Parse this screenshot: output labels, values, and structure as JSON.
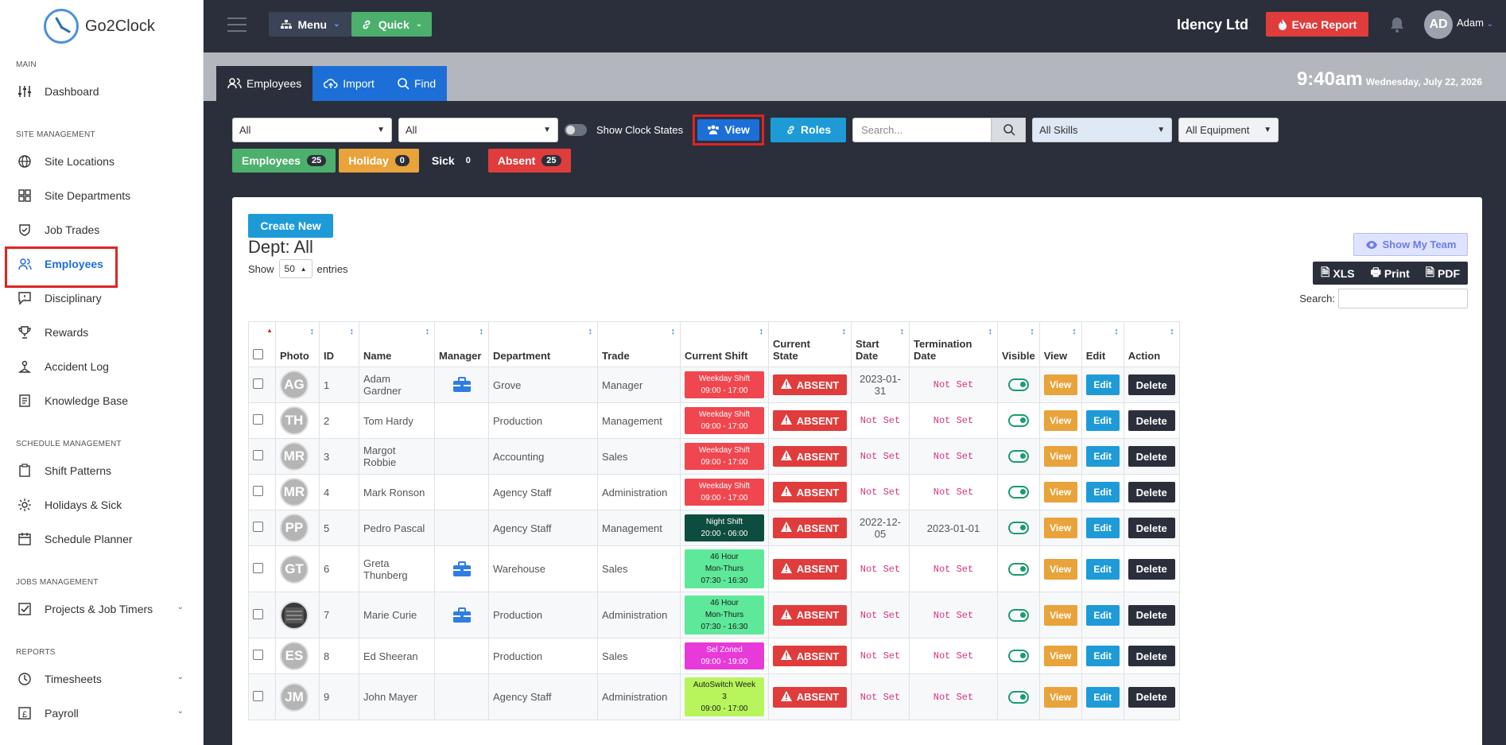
{
  "app": {
    "brand": "Go2Clock"
  },
  "sidebar": {
    "sections": [
      {
        "title": "MAIN",
        "items": [
          {
            "label": "Dashboard",
            "icon": "sliders-icon"
          }
        ]
      },
      {
        "title": "SITE MANAGEMENT",
        "items": [
          {
            "label": "Site Locations",
            "icon": "globe-icon"
          },
          {
            "label": "Site Departments",
            "icon": "grid-icon"
          },
          {
            "label": "Job Trades",
            "icon": "shield-icon"
          },
          {
            "label": "Employees",
            "icon": "users-icon",
            "active": true
          },
          {
            "label": "Disciplinary",
            "icon": "message-icon"
          },
          {
            "label": "Rewards",
            "icon": "trophy-icon"
          },
          {
            "label": "Accident Log",
            "icon": "hazard-icon"
          },
          {
            "label": "Knowledge Base",
            "icon": "book-icon"
          }
        ]
      },
      {
        "title": "SCHEDULE MANAGEMENT",
        "items": [
          {
            "label": "Shift Patterns",
            "icon": "clipboard-icon"
          },
          {
            "label": "Holidays & Sick",
            "icon": "sun-icon"
          },
          {
            "label": "Schedule Planner",
            "icon": "calendar-icon"
          }
        ]
      },
      {
        "title": "JOBS MANAGEMENT",
        "items": [
          {
            "label": "Projects & Job Timers",
            "icon": "checkbox-icon",
            "expandable": true
          }
        ]
      },
      {
        "title": "REPORTS",
        "items": [
          {
            "label": "Timesheets",
            "icon": "clock-icon",
            "expandable": true
          },
          {
            "label": "Payroll",
            "icon": "pound-icon",
            "expandable": true
          }
        ]
      }
    ]
  },
  "topbar": {
    "menu_label": "Menu",
    "quick_label": "Quick",
    "company": "Idency Ltd",
    "evac_label": "Evac Report",
    "avatar_initials": "AD",
    "user_name": "Adam"
  },
  "tabs": [
    {
      "label": "Employees",
      "icon": "users-icon",
      "active": true
    },
    {
      "label": "Import",
      "icon": "cloud-upload-icon"
    },
    {
      "label": "Find",
      "icon": "search-icon"
    }
  ],
  "clock": {
    "time": "9:40am",
    "date": "Wednesday, July 22, 2026"
  },
  "filters": {
    "select1": "All",
    "select2": "All",
    "show_clock_states": "Show Clock States",
    "view_label": "View",
    "roles_label": "Roles",
    "search_placeholder": "Search...",
    "skills": "All Skills",
    "equipment": "All Equipment"
  },
  "badges": [
    {
      "label": "Employees",
      "count": "25"
    },
    {
      "label": "Holiday",
      "count": "0"
    },
    {
      "label": "Sick",
      "count": "0"
    },
    {
      "label": "Absent",
      "count": "25"
    }
  ],
  "card": {
    "create_label": "Create New",
    "dept_title": "Dept: All",
    "show_label": "Show",
    "entries_value": "50",
    "entries_label": "entries",
    "my_team_label": "Show My Team",
    "xls_label": "XLS",
    "print_label": "Print",
    "pdf_label": "PDF",
    "search_label": "Search:"
  },
  "columns": [
    "Photo",
    "ID",
    "Name",
    "Manager",
    "Department",
    "Trade",
    "Current Shift",
    "Current State",
    "Start Date",
    "Termination Date",
    "Visible",
    "View",
    "Edit",
    "Action"
  ],
  "colors": {
    "weekday": "#f0464f",
    "night": "#0d4d3f",
    "four6": "#5ee89a",
    "sel": "#e83ad9",
    "autoswitch": "#b8f55c"
  },
  "rows": [
    {
      "initials": "AG",
      "id": "1",
      "name": "Adam Gardner",
      "manager": true,
      "dept": "Grove",
      "trade": "Manager",
      "shift": [
        "Weekday Shift",
        "09:00 - 17:00"
      ],
      "shift_color": "#f0464f",
      "state": "ABSENT",
      "start": "2023-01-31",
      "term": "Not Set"
    },
    {
      "initials": "TH",
      "id": "2",
      "name": "Tom Hardy",
      "manager": false,
      "dept": "Production",
      "trade": "Management",
      "shift": [
        "Weekday Shift",
        "09:00 - 17:00"
      ],
      "shift_color": "#f0464f",
      "state": "ABSENT",
      "start": "Not Set",
      "term": "Not Set"
    },
    {
      "initials": "MR",
      "id": "3",
      "name": "Margot Robbie",
      "manager": false,
      "dept": "Accounting",
      "trade": "Sales",
      "shift": [
        "Weekday Shift",
        "09:00 - 17:00"
      ],
      "shift_color": "#f0464f",
      "state": "ABSENT",
      "start": "Not Set",
      "term": "Not Set"
    },
    {
      "initials": "MR",
      "id": "4",
      "name": "Mark Ronson",
      "manager": false,
      "dept": "Agency Staff",
      "trade": "Administration",
      "shift": [
        "Weekday Shift",
        "09:00 - 17:00"
      ],
      "shift_color": "#f0464f",
      "state": "ABSENT",
      "start": "Not Set",
      "term": "Not Set"
    },
    {
      "initials": "PP",
      "id": "5",
      "name": "Pedro Pascal",
      "manager": false,
      "dept": "Agency Staff",
      "trade": "Management",
      "shift": [
        "Night Shift",
        "20:00 - 06:00"
      ],
      "shift_color": "#0d4d3f",
      "state": "ABSENT",
      "start": "2022-12-05",
      "term": "2023-01-01"
    },
    {
      "initials": "GT",
      "id": "6",
      "name": "Greta Thunberg",
      "manager": true,
      "dept": "Warehouse",
      "trade": "Sales",
      "shift": [
        "46 Hour",
        "Mon-Thurs",
        "07:30 - 16:30"
      ],
      "shift_color": "#5ee89a",
      "shift_text_dark": true,
      "state": "ABSENT",
      "start": "Not Set",
      "term": "Not Set"
    },
    {
      "initials": "",
      "photo": true,
      "id": "7",
      "name": "Marie Curie",
      "manager": true,
      "dept": "Production",
      "trade": "Administration",
      "shift": [
        "46 Hour",
        "Mon-Thurs",
        "07:30 - 16:30"
      ],
      "shift_color": "#5ee89a",
      "shift_text_dark": true,
      "state": "ABSENT",
      "start": "Not Set",
      "term": "Not Set"
    },
    {
      "initials": "ES",
      "id": "8",
      "name": "Ed Sheeran",
      "manager": false,
      "dept": "Production",
      "trade": "Sales",
      "shift": [
        "Sel Zoned",
        "09:00 - 19:00"
      ],
      "shift_color": "#e83ad9",
      "state": "ABSENT",
      "start": "Not Set",
      "term": "Not Set"
    },
    {
      "initials": "JM",
      "id": "9",
      "name": "John Mayer",
      "manager": false,
      "dept": "Agency Staff",
      "trade": "Administration",
      "shift": [
        "AutoSwitch Week",
        "3",
        "09:00 - 17:00"
      ],
      "shift_color": "#b8f55c",
      "shift_text_dark": true,
      "state": "ABSENT",
      "start": "Not Set",
      "term": "Not Set"
    }
  ],
  "row_buttons": {
    "view": "View",
    "edit": "Edit",
    "delete": "Delete"
  }
}
